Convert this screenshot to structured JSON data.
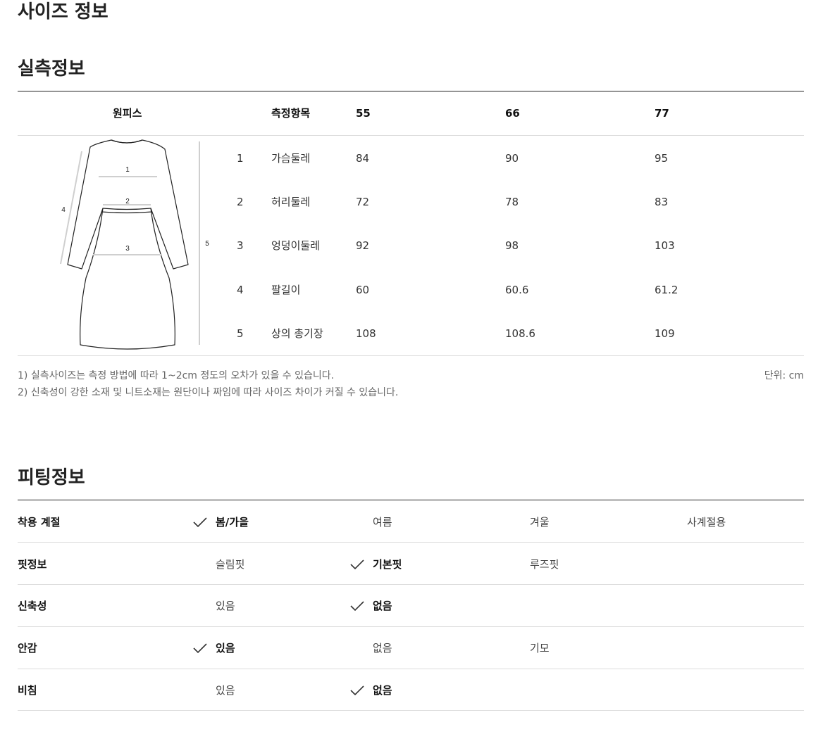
{
  "page_title": "사이즈 정보",
  "measure": {
    "title": "실측정보",
    "product_label": "원피스",
    "col_item": "측정항목",
    "sizes": [
      "55",
      "66",
      "77"
    ],
    "rows": [
      {
        "no": "1",
        "name": "가슴둘레",
        "values": [
          "84",
          "90",
          "95"
        ]
      },
      {
        "no": "2",
        "name": "허리둘레",
        "values": [
          "72",
          "78",
          "83"
        ]
      },
      {
        "no": "3",
        "name": "엉덩이둘레",
        "values": [
          "92",
          "98",
          "103"
        ]
      },
      {
        "no": "4",
        "name": "팔길이",
        "values": [
          "60",
          "60.6",
          "61.2"
        ]
      },
      {
        "no": "5",
        "name": "상의 총기장",
        "values": [
          "108",
          "108.6",
          "109"
        ]
      }
    ],
    "diagram_labels": [
      "1",
      "2",
      "3",
      "4",
      "5"
    ],
    "note1": "1) 실측사이즈는 측정 방법에 따라 1~2cm 정도의 오차가 있을 수 있습니다.",
    "note2": "2) 신축성이 강한 소재 및 니트소재는 원단이나 짜임에 따라 사이즈 차이가 커질 수 있습니다.",
    "unit": "단위: cm"
  },
  "fitting": {
    "title": "피팅정보",
    "rows": [
      {
        "label": "착용 계절",
        "options": [
          {
            "text": "봄/가을",
            "selected": true
          },
          {
            "text": "여름",
            "selected": false
          },
          {
            "text": "겨울",
            "selected": false
          },
          {
            "text": "사계절용",
            "selected": false
          }
        ]
      },
      {
        "label": "핏정보",
        "options": [
          {
            "text": "슬림핏",
            "selected": false
          },
          {
            "text": "기본핏",
            "selected": true
          },
          {
            "text": "루즈핏",
            "selected": false
          }
        ]
      },
      {
        "label": "신축성",
        "options": [
          {
            "text": "있음",
            "selected": false
          },
          {
            "text": "없음",
            "selected": true
          }
        ]
      },
      {
        "label": "안감",
        "options": [
          {
            "text": "있음",
            "selected": true
          },
          {
            "text": "없음",
            "selected": false
          },
          {
            "text": "기모",
            "selected": false
          }
        ]
      },
      {
        "label": "비침",
        "options": [
          {
            "text": "있음",
            "selected": false
          },
          {
            "text": "없음",
            "selected": true
          }
        ]
      }
    ]
  },
  "colors": {
    "text": "#222222",
    "muted": "#666666",
    "divider": "#dcdcdc",
    "check": "#333333"
  }
}
